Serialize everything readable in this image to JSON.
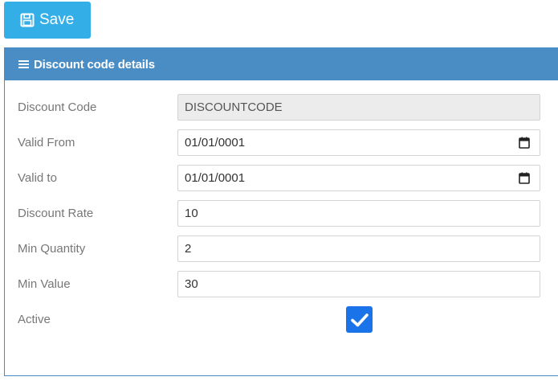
{
  "toolbar": {
    "save_label": "Save"
  },
  "panel": {
    "title": "Discount code details"
  },
  "form": {
    "discount_code": {
      "label": "Discount Code",
      "value": "DISCOUNTCODE"
    },
    "valid_from": {
      "label": "Valid From",
      "value": "01/01/0001"
    },
    "valid_to": {
      "label": "Valid to",
      "value": "01/01/0001"
    },
    "discount_rate": {
      "label": "Discount Rate",
      "value": "10"
    },
    "min_quantity": {
      "label": "Min Quantity",
      "value": "2"
    },
    "min_value": {
      "label": "Min Value",
      "value": "30"
    },
    "active": {
      "label": "Active",
      "checked": true
    }
  },
  "colors": {
    "save_button": "#34aee6",
    "panel_header": "#4a8cc4",
    "checkbox": "#1a73e8",
    "label_text": "#777777"
  },
  "icons": {
    "save": "floppy-disk-icon",
    "header": "hamburger-menu-icon",
    "calendar": "calendar-icon",
    "check": "checkmark-icon"
  }
}
